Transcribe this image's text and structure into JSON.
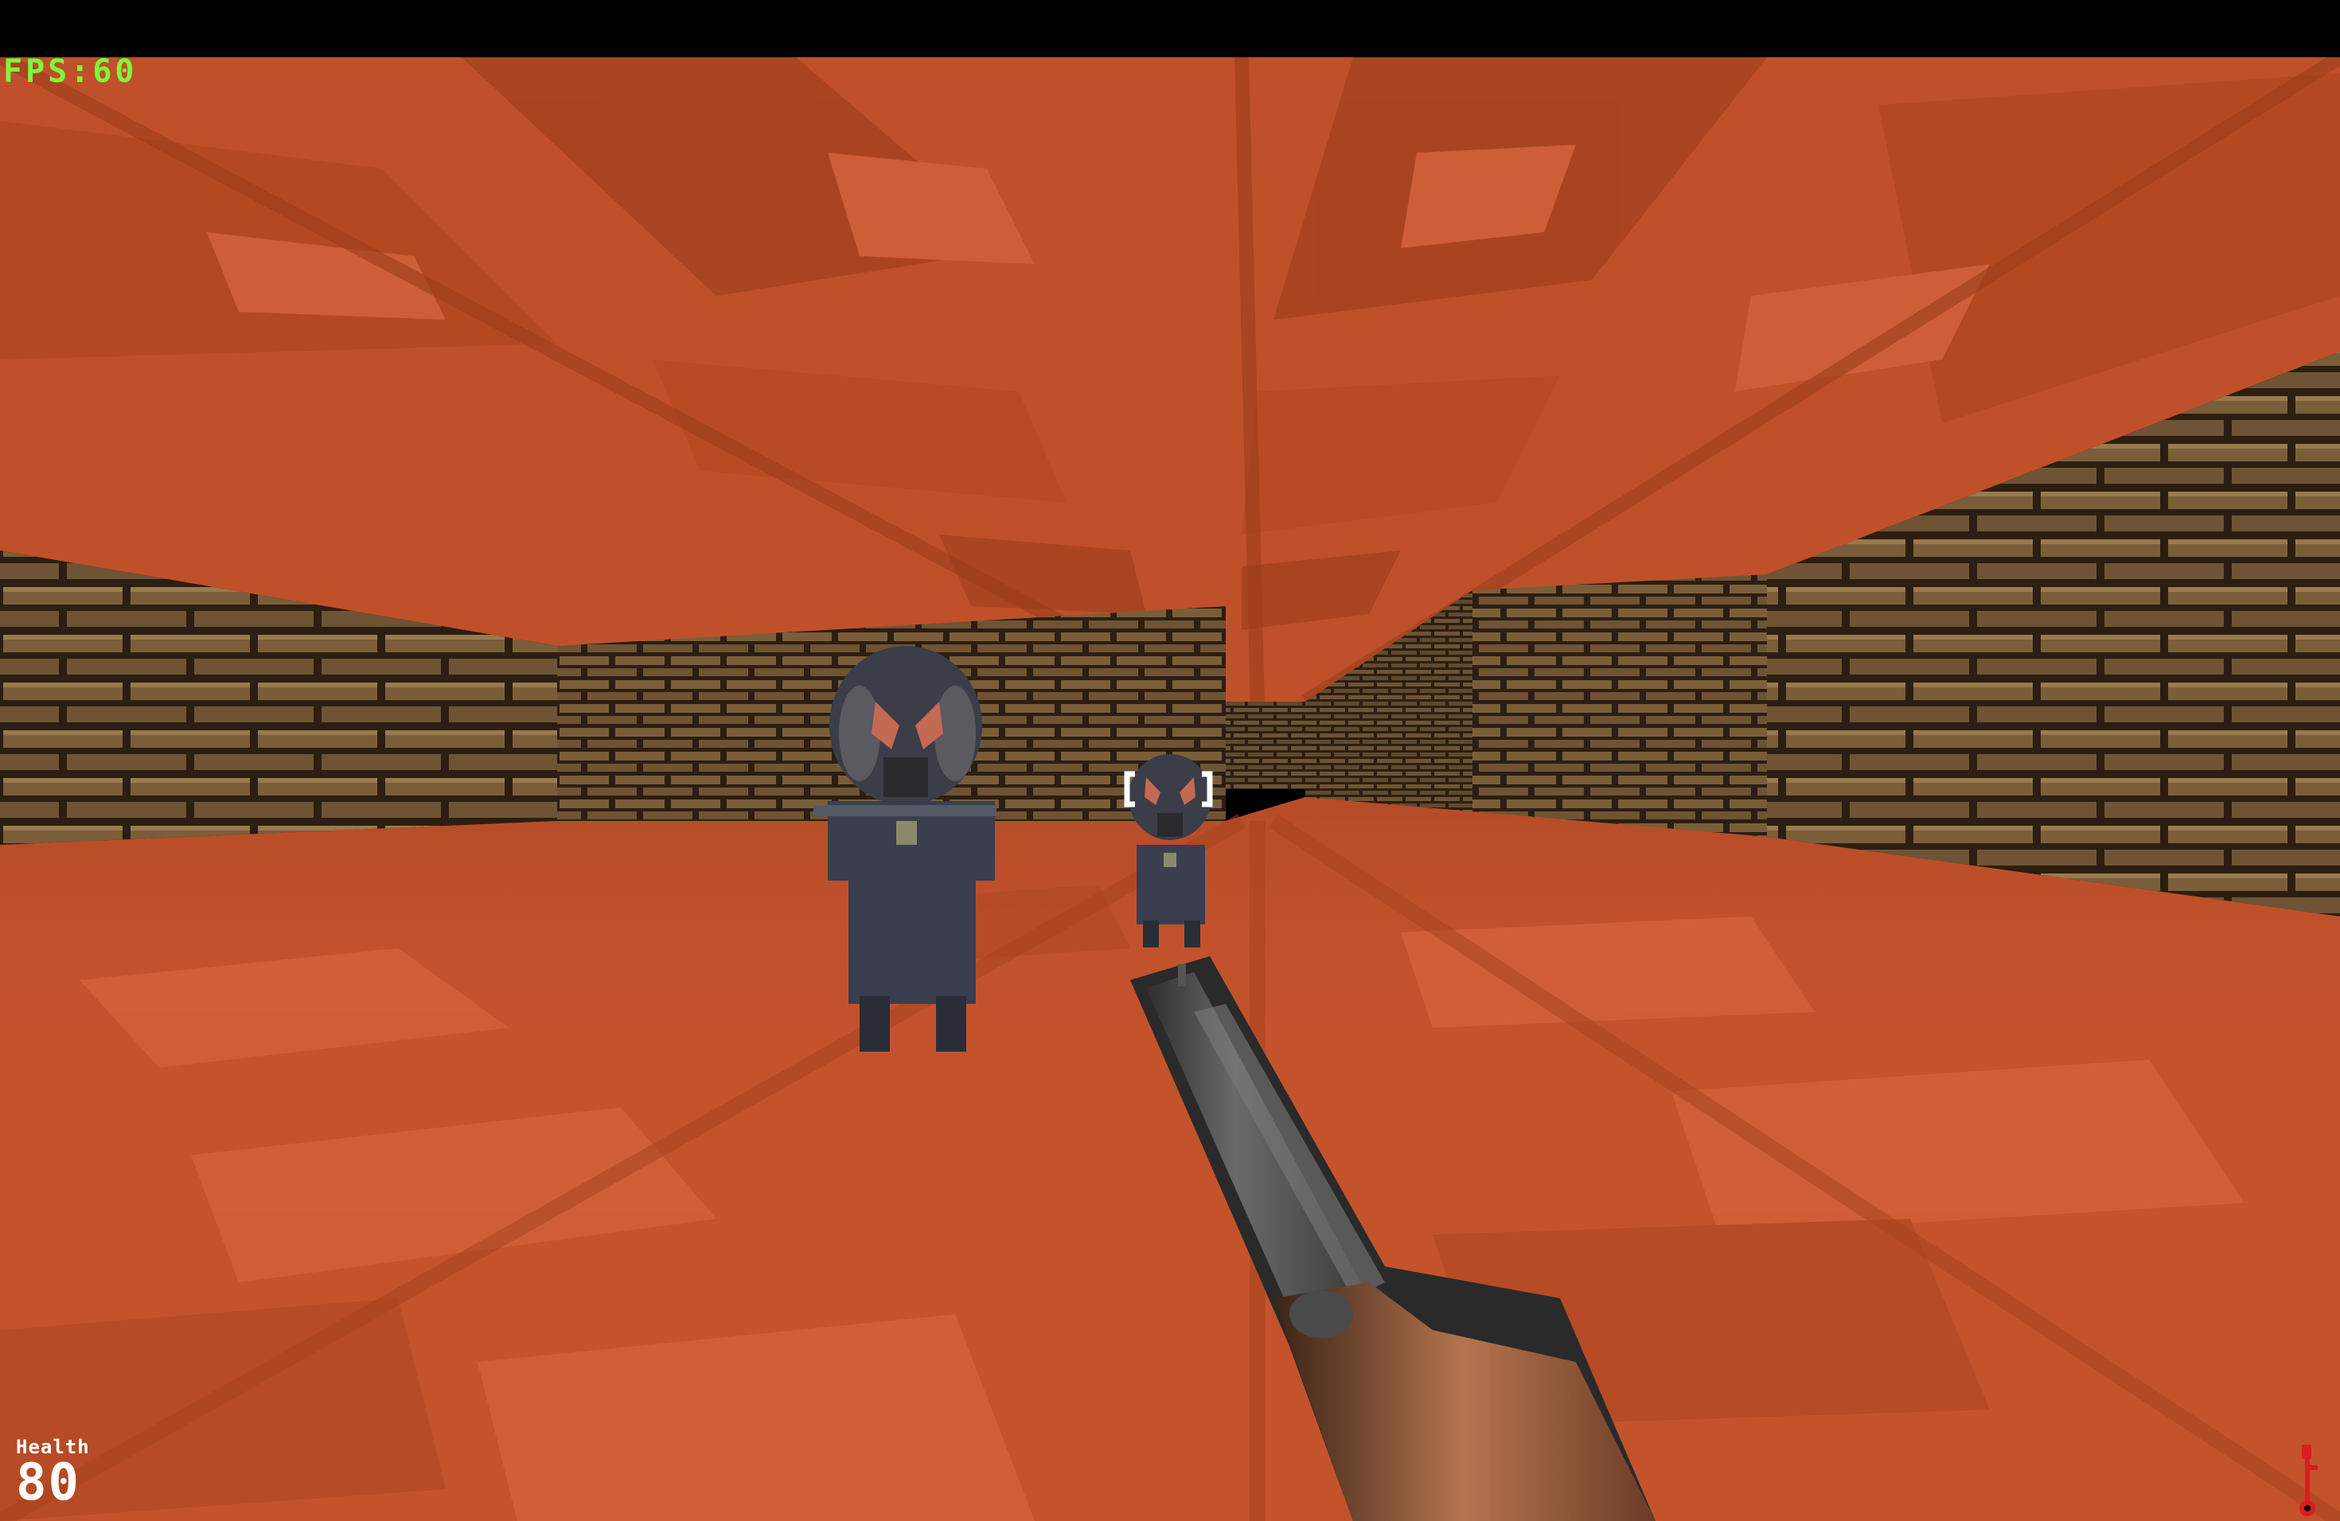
{
  "hud": {
    "fps_text": "FPS:60",
    "fps_color": "#7CFC3A",
    "health_label": "Health",
    "health_value": "80"
  },
  "scene": {
    "enemies": [
      {
        "name": "gasmask-soldier-near"
      },
      {
        "name": "gasmask-soldier-far"
      }
    ],
    "weapon": "double-barrel-shotgun",
    "key_icon": "red-key-icon",
    "colors": {
      "floor": "#C4532C",
      "ceiling": "#C0502A",
      "wall_mortar": "#2C1E12",
      "wall_brick": "#7A5E3A",
      "key": "#D81E1E"
    }
  }
}
